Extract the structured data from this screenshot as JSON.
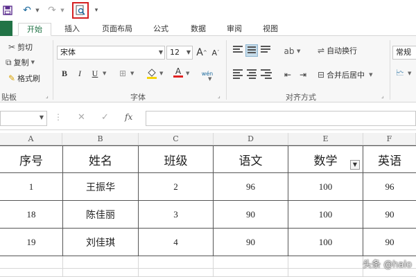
{
  "quick_access": {
    "undo_icon": "undo-icon",
    "redo_icon": "redo-icon",
    "preview_icon": "print-preview-icon",
    "preview_highlight_color": "#d42020"
  },
  "tabs": {
    "file": "",
    "active": "开始",
    "items": [
      "插入",
      "页面布局",
      "公式",
      "数据",
      "审阅",
      "视图"
    ]
  },
  "ribbon": {
    "clipboard": {
      "cut": "剪切",
      "copy": "复制",
      "format_painter": "格式刷",
      "label": "贴板"
    },
    "font": {
      "name": "宋体",
      "size": "12",
      "grow": "A",
      "shrink": "A",
      "bold": "B",
      "italic": "I",
      "underline": "U",
      "font_color_letter": "A",
      "phonetic": "wén",
      "label": "字体",
      "fill_color": "#f5d300",
      "font_color": "#e02020"
    },
    "alignment": {
      "wrap_text": "自动换行",
      "merge_center": "合并后居中",
      "label": "对齐方式"
    },
    "number": {
      "format": "常规"
    }
  },
  "formula_bar": {
    "name_box": "",
    "cancel": "✕",
    "enter": "✓",
    "fx": "fx",
    "value": ""
  },
  "sheet": {
    "columns": [
      "A",
      "B",
      "C",
      "D",
      "E",
      "F"
    ],
    "headers": [
      "序号",
      "姓名",
      "班级",
      "语文",
      "数学",
      "英语"
    ],
    "rows": [
      [
        "1",
        "王振华",
        "2",
        "96",
        "100",
        "96"
      ],
      [
        "18",
        "陈佳丽",
        "3",
        "90",
        "100",
        "90"
      ],
      [
        "19",
        "刘佳琪",
        "4",
        "90",
        "100",
        "90"
      ]
    ],
    "filter_column": "数学"
  },
  "watermark": "头条 @halo"
}
